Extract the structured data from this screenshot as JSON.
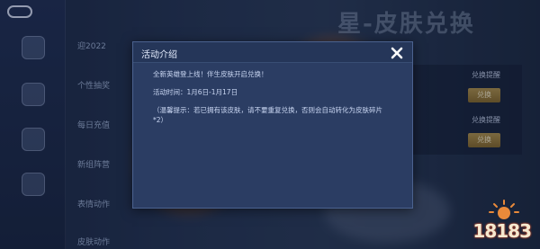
{
  "dialog": {
    "title": "活动介绍",
    "lines": [
      "全新英雄登上线！伴生皮肤开启兑换！",
      "活动时间：1月6日-1月17日",
      "（温馨提示：若已拥有该皮肤，请不要重复兑换，否则会自动转化为皮肤碎片",
      "*2）"
    ]
  },
  "background": {
    "title_art": "星-皮肤兑换",
    "list_items": [
      "迎2022",
      "个性抽奖",
      "每日充值",
      "新组阵营",
      "表情动作",
      "皮肤动作"
    ],
    "exchange_label": "兑换",
    "exchange_hint": "兑换提醒"
  },
  "watermark": "18183",
  "colors": {
    "dialog_bg": "#2b3d63",
    "accent_gold": "#b99a52"
  }
}
